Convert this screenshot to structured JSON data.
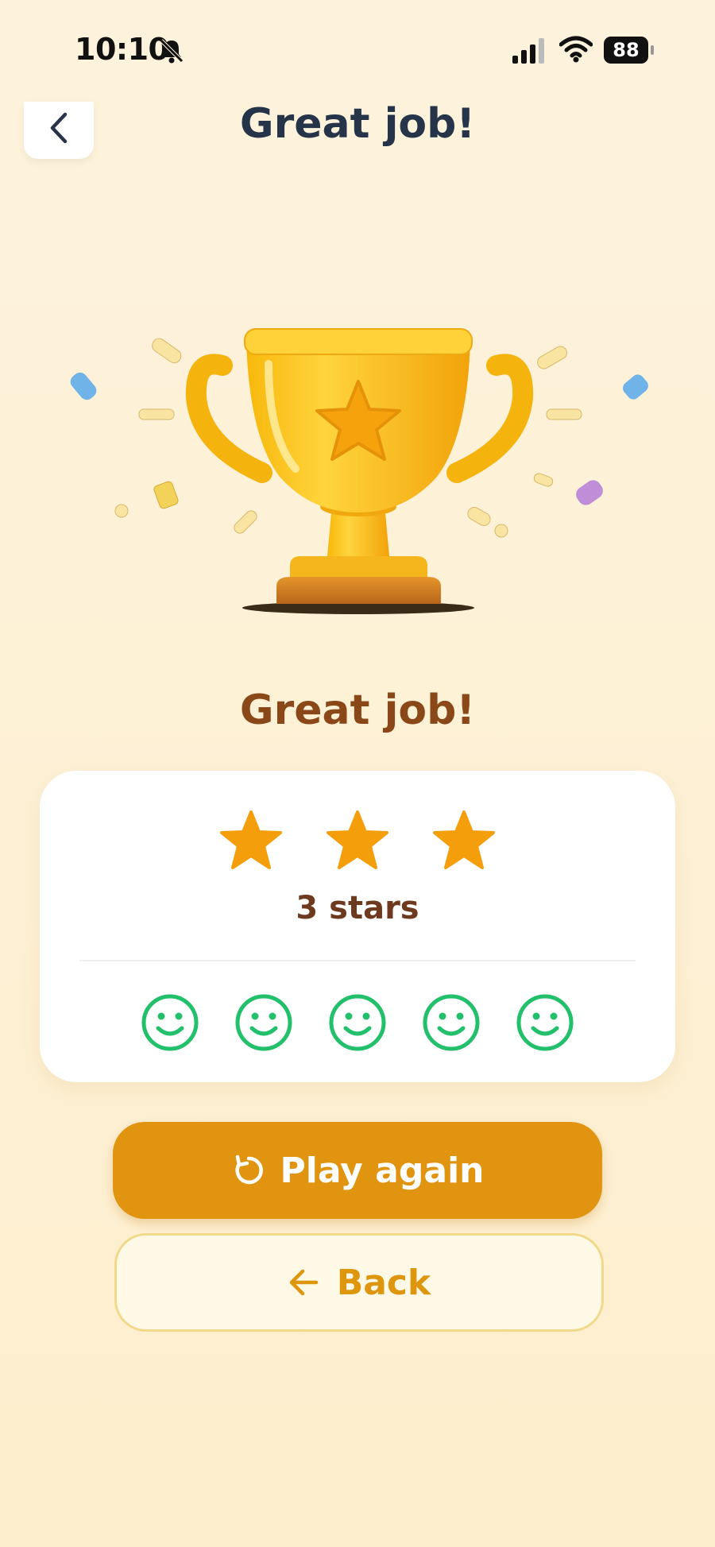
{
  "status_bar": {
    "time": "10:10",
    "battery": "88",
    "icons": [
      "bell-slash-icon",
      "signal-icon",
      "wifi-icon",
      "battery-icon"
    ]
  },
  "header": {
    "title": "Great job!",
    "back_icon": "chevron-left-icon"
  },
  "hero": {
    "image": "trophy-illustration",
    "headline": "Great job!"
  },
  "result_card": {
    "stars_earned": 3,
    "stars_total": 3,
    "stars_label": "3 stars",
    "faces": [
      "smile-face-icon",
      "smile-face-icon",
      "smile-face-icon",
      "smile-face-icon",
      "smile-face-icon"
    ]
  },
  "actions": {
    "play_again_label": "Play again",
    "play_again_icon": "refresh-icon",
    "back_label": "Back",
    "back_icon": "arrow-left-icon"
  },
  "colors": {
    "background": "#fdf3dc",
    "title": "#26344a",
    "headline": "#8a4717",
    "star": "#f59e0b",
    "face": "#22c06b",
    "primary_button": "#e1940f",
    "secondary_button_text": "#de960f"
  }
}
